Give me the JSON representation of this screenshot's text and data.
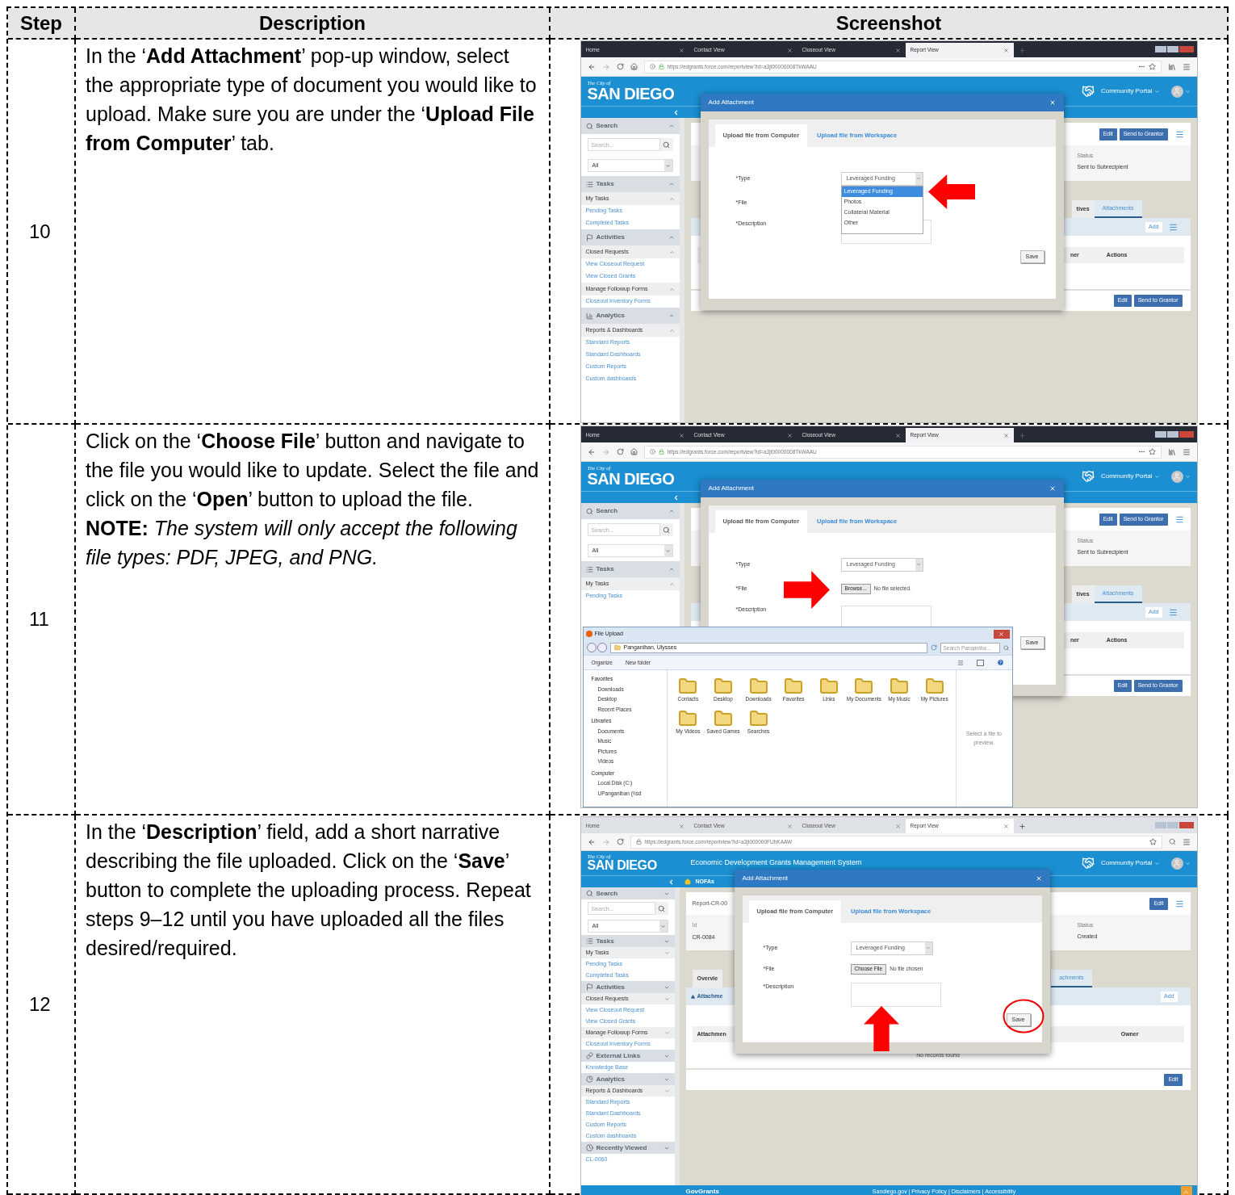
{
  "table": {
    "columns": [
      "Step",
      "Description",
      "Screenshot"
    ],
    "rows": [
      {
        "step": "10",
        "description": "In the ‘**Add Attachment**’ pop-up window, select the appropriate type of document you would like to upload. Make sure you are under the ‘**Upload File from Computer**’ tab.",
        "screenshot": {
          "browser": {
            "tabs": [
              {
                "label": "Home",
                "selected": false
              },
              {
                "label": "Contact View",
                "selected": false
              },
              {
                "label": "Closeout View",
                "selected": false
              },
              {
                "label": "Report View",
                "selected": true
              }
            ],
            "url": "https://edgrants.force.com/reportview?id=a3jt00000008TkWAAU"
          },
          "header": {
            "city": "The City of",
            "name": "SAN DIEGO",
            "portal": "Community Portal"
          },
          "sidebar": [
            {
              "kind": "section",
              "label": "Search"
            },
            {
              "kind": "search",
              "placeholder": "Search..."
            },
            {
              "kind": "select",
              "value": "All"
            },
            {
              "kind": "section",
              "label": "Tasks"
            },
            {
              "kind": "group",
              "label": "My Tasks"
            },
            {
              "kind": "link",
              "label": "Pending Tasks"
            },
            {
              "kind": "link",
              "label": "Completed Tasks"
            },
            {
              "kind": "section",
              "label": "Activities"
            },
            {
              "kind": "group",
              "label": "Closed Requests"
            },
            {
              "kind": "link",
              "label": "View Closeout Request"
            },
            {
              "kind": "link",
              "label": "View Closed Grants"
            },
            {
              "kind": "group",
              "label": "Manage Followup Forms"
            },
            {
              "kind": "link",
              "label": "Closeout Inventory Forms"
            },
            {
              "kind": "section",
              "label": "Analytics"
            },
            {
              "kind": "group",
              "label": "Reports & Dashboards"
            },
            {
              "kind": "link",
              "label": "Standard Reports"
            },
            {
              "kind": "link",
              "label": "Standard Dashboards"
            },
            {
              "kind": "link",
              "label": "Custom Reports"
            },
            {
              "kind": "link",
              "label": "Custom dashboards"
            }
          ],
          "main": {
            "record": {
              "buttons": [
                "Edit",
                "Send to Grantor"
              ],
              "status_label": "Status",
              "status_value": "Sent to Subrecipient"
            },
            "tabs": [
              {
                "label": "tives",
                "selected": false
              },
              {
                "label": "Attachments",
                "selected": true
              }
            ],
            "related": {
              "add": "Add",
              "columns": [
                "ner",
                "Actions"
              ]
            },
            "actions": [
              "Edit",
              "Send to Grantor"
            ]
          },
          "dialog": {
            "title": "Add Attachment",
            "tabs": [
              {
                "label": "Upload file from Computer",
                "selected": true
              },
              {
                "label": "Upload file from Workspace",
                "selected": false
              }
            ],
            "fields": [
              {
                "kind": "select",
                "label": "*Type",
                "value": "Leveraged Funding",
                "options": [
                  {
                    "label": "Leveraged Funding",
                    "selected": true
                  },
                  {
                    "label": "Photos",
                    "selected": false
                  },
                  {
                    "label": "Collateral Material",
                    "selected": false
                  },
                  {
                    "label": "Other",
                    "selected": false
                  }
                ]
              },
              {
                "kind": "file",
                "label": "*File"
              },
              {
                "kind": "textarea",
                "label": "*Description"
              }
            ],
            "save": "Save"
          }
        }
      },
      {
        "step": "11",
        "description": "Click on the ‘**Choose File**’ button and navigate to the file you would like to update. Select the file and click on the ‘**Open**’ button to upload the file. **NOTE:** *The system will only accept the following file types: PDF, JPEG, and PNG.*",
        "screenshot": {
          "browser": {
            "tabs": [
              {
                "label": "Home",
                "selected": false
              },
              {
                "label": "Contact View",
                "selected": false
              },
              {
                "label": "Closeout View",
                "selected": false
              },
              {
                "label": "Report View",
                "selected": true
              }
            ],
            "url": "https://edgrants.force.com/reportview?id=a3jt00000008TkWAAU"
          },
          "header": {
            "city": "The City of",
            "name": "SAN DIEGO",
            "portal": "Community Portal"
          },
          "sidebar": [
            {
              "kind": "section",
              "label": "Search"
            },
            {
              "kind": "search",
              "placeholder": "Search..."
            },
            {
              "kind": "select",
              "value": "All"
            },
            {
              "kind": "section",
              "label": "Tasks"
            },
            {
              "kind": "group",
              "label": "My Tasks"
            },
            {
              "kind": "link",
              "label": "Pending Tasks"
            }
          ],
          "main": {
            "record": {
              "buttons": [
                "Edit",
                "Send to Grantor"
              ],
              "status_label": "Status",
              "status_value": "Sent to Subrecipient"
            },
            "tabs": [
              {
                "label": "tives",
                "selected": false
              },
              {
                "label": "Attachments",
                "selected": true
              }
            ],
            "related": {
              "add": "Add",
              "columns": [
                "ner",
                "Actions"
              ]
            },
            "actions": [
              "Edit",
              "Send to Grantor"
            ]
          },
          "dialog": {
            "title": "Add Attachment",
            "tabs": [
              {
                "label": "Upload file from Computer",
                "selected": true
              },
              {
                "label": "Upload file from Workspace",
                "selected": false
              }
            ],
            "fields": [
              {
                "kind": "select",
                "label": "*Type",
                "value": "Leveraged Funding"
              },
              {
                "kind": "file",
                "label": "*File",
                "button": "Browse...",
                "status": "No file selected."
              },
              {
                "kind": "textarea",
                "label": "*Description"
              }
            ],
            "save": "Save"
          },
          "file_upload": {
            "title": "File Upload",
            "path": "Panganiban, Ulysses",
            "search_placeholder": "Search Panganiba...",
            "toolbar": [
              "Organize",
              "New folder"
            ],
            "nav": [
              {
                "kind": "header",
                "label": "Favorites"
              },
              {
                "kind": "item",
                "label": "Downloads"
              },
              {
                "kind": "item",
                "label": "Desktop"
              },
              {
                "kind": "item",
                "label": "Recent Places"
              },
              {
                "kind": "header",
                "label": "Libraries"
              },
              {
                "kind": "item",
                "label": "Documents"
              },
              {
                "kind": "item",
                "label": "Music"
              },
              {
                "kind": "item",
                "label": "Pictures"
              },
              {
                "kind": "item",
                "label": "Videos"
              },
              {
                "kind": "header",
                "label": "Computer"
              },
              {
                "kind": "item",
                "label": "Local Disk (C:)"
              },
              {
                "kind": "item",
                "label": "UPanganiban (\\\\sd"
              }
            ],
            "folders": [
              "Contacts",
              "Desktop",
              "Downloads",
              "Favorites",
              "Links",
              "My Documents",
              "My Music",
              "My Pictures",
              "My Videos",
              "Saved Games",
              "Searches"
            ],
            "preview": "Select a file to preview."
          }
        }
      },
      {
        "step": "12",
        "description": "In the ‘**Description**’ field, add a short narrative describing the file uploaded. Click on the ‘**Save**’ button to complete the uploading process. Repeat steps 9–12 until you have uploaded all the files desired/required.",
        "screenshot": {
          "browser": {
            "tabs": [
              {
                "label": "Home",
                "selected": false
              },
              {
                "label": "Contact View",
                "selected": false
              },
              {
                "label": "Closeout View",
                "selected": false
              },
              {
                "label": "Report View",
                "selected": true
              }
            ],
            "url": "https://edgrants.force.com/reportview?id=a3jt000000FUbKAAW"
          },
          "header": {
            "city": "The City of",
            "name": "SAN DIEGO",
            "title": "Economic Development Grants Management System",
            "portal": "Community Portal",
            "breadcrumb": "NOFAs"
          },
          "sidebar": [
            {
              "kind": "section",
              "label": "Search"
            },
            {
              "kind": "search",
              "placeholder": "Search..."
            },
            {
              "kind": "select",
              "value": "All"
            },
            {
              "kind": "section",
              "label": "Tasks"
            },
            {
              "kind": "group",
              "label": "My Tasks"
            },
            {
              "kind": "link",
              "label": "Pending Tasks"
            },
            {
              "kind": "link",
              "label": "Completed Tasks"
            },
            {
              "kind": "section",
              "label": "Activities"
            },
            {
              "kind": "group",
              "label": "Closed Requests"
            },
            {
              "kind": "link",
              "label": "View Closeout Request"
            },
            {
              "kind": "link",
              "label": "View Closed Grants"
            },
            {
              "kind": "group",
              "label": "Manage Followup Forms"
            },
            {
              "kind": "link",
              "label": "Closeout Inventory Forms"
            },
            {
              "kind": "section",
              "label": "External Links"
            },
            {
              "kind": "link",
              "label": "Knowledge Base"
            },
            {
              "kind": "section",
              "label": "Analytics"
            },
            {
              "kind": "group",
              "label": "Reports & Dashboards"
            },
            {
              "kind": "link",
              "label": "Standard Reports"
            },
            {
              "kind": "link",
              "label": "Standard Dashboards"
            },
            {
              "kind": "link",
              "label": "Custom Reports"
            },
            {
              "kind": "link",
              "label": "Custom dashboards"
            },
            {
              "kind": "section",
              "label": "Recently Viewed"
            },
            {
              "kind": "link",
              "label": "CL-0060"
            }
          ],
          "main": {
            "record": {
              "title": "Report-CR-00",
              "id_label": "Id",
              "id_value": "CR-0084",
              "buttons": [
                "Edit"
              ],
              "status_label": "Status",
              "status_value": "Created"
            },
            "tabs": [
              {
                "label": "Overvie",
                "selected": false
              },
              {
                "label": "achments",
                "selected": true
              }
            ],
            "related": {
              "heading": "Attachme",
              "add": "Add",
              "columns": [
                "Attachmen",
                "Owner"
              ],
              "empty": "No records found"
            },
            "actions": [
              "Edit"
            ]
          },
          "dialog": {
            "title": "Add Attachment",
            "tabs": [
              {
                "label": "Upload file from Computer",
                "selected": true
              },
              {
                "label": "Upload file from Workspace",
                "selected": false
              }
            ],
            "fields": [
              {
                "kind": "select",
                "label": "*Type",
                "value": "Leveraged Funding"
              },
              {
                "kind": "file",
                "label": "*File",
                "button": "Choose File",
                "status": "No file chosen"
              },
              {
                "kind": "textarea",
                "label": "*Description"
              }
            ],
            "save": "Save"
          },
          "footer": {
            "brand": "GovGrants",
            "links": "Sandiego.gov | Privacy Policy | Disclaimers | Accessibility"
          }
        }
      }
    ]
  }
}
